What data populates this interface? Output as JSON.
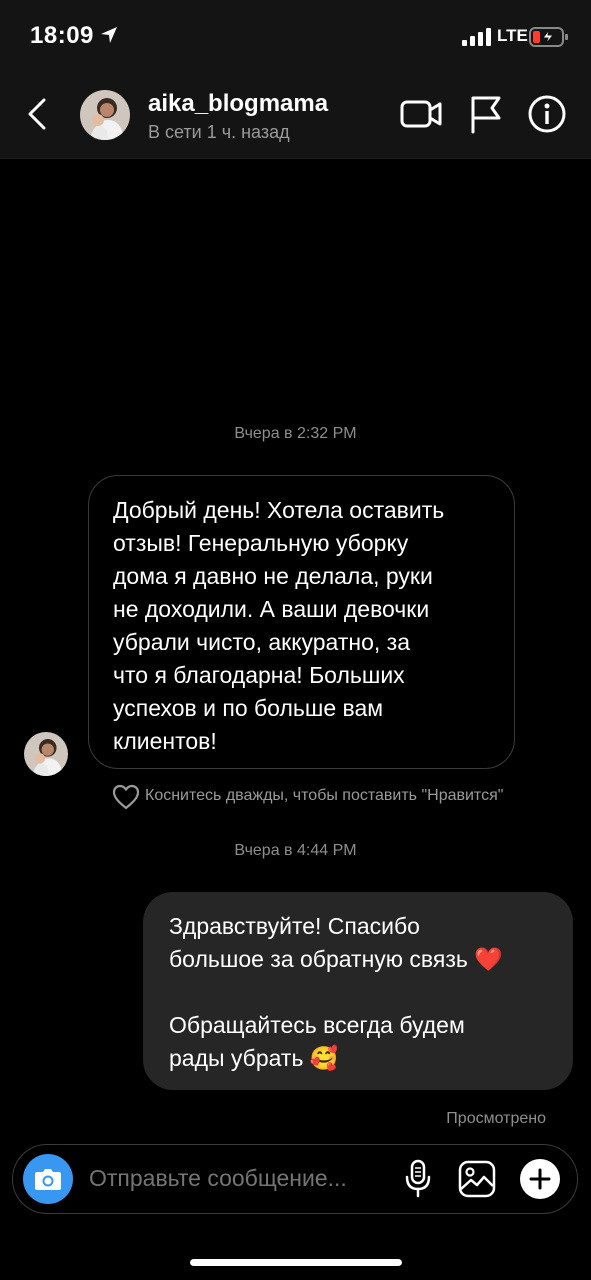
{
  "status_bar": {
    "time": "18:09",
    "network": "LTE"
  },
  "header": {
    "username": "aika_blogmama",
    "presence": "В сети 1 ч. назад"
  },
  "messages": [
    {
      "timestamp": "Вчера в 2:32 PM",
      "direction": "incoming",
      "text": "Добрый день! Хотела оставить\nотзыв! Генеральную уборку\nдома я давно не делала, руки\nне доходили. А ваши девочки\nубрали чисто, аккуратно, за\nчто я благодарна! Больших\nуспехов и по больше вам\nклиентов!",
      "like_hint": "Коснитесь дважды, чтобы поставить \"Нравится\""
    },
    {
      "timestamp": "Вчера в 4:44 PM",
      "direction": "outgoing",
      "text": "Здравствуйте! Спасибо\nбольшое за обратную связь ❤️\n\nОбращайтесь всегда будем\nрады убрать 🥰",
      "status": "Просмотрено"
    }
  ],
  "composer": {
    "placeholder": "Отправьте сообщение..."
  },
  "colors": {
    "background": "#000000",
    "header": "#141414",
    "outgoing_bubble": "#262626",
    "camera_button": "#3897f0",
    "battery_low": "#ff3b30"
  }
}
